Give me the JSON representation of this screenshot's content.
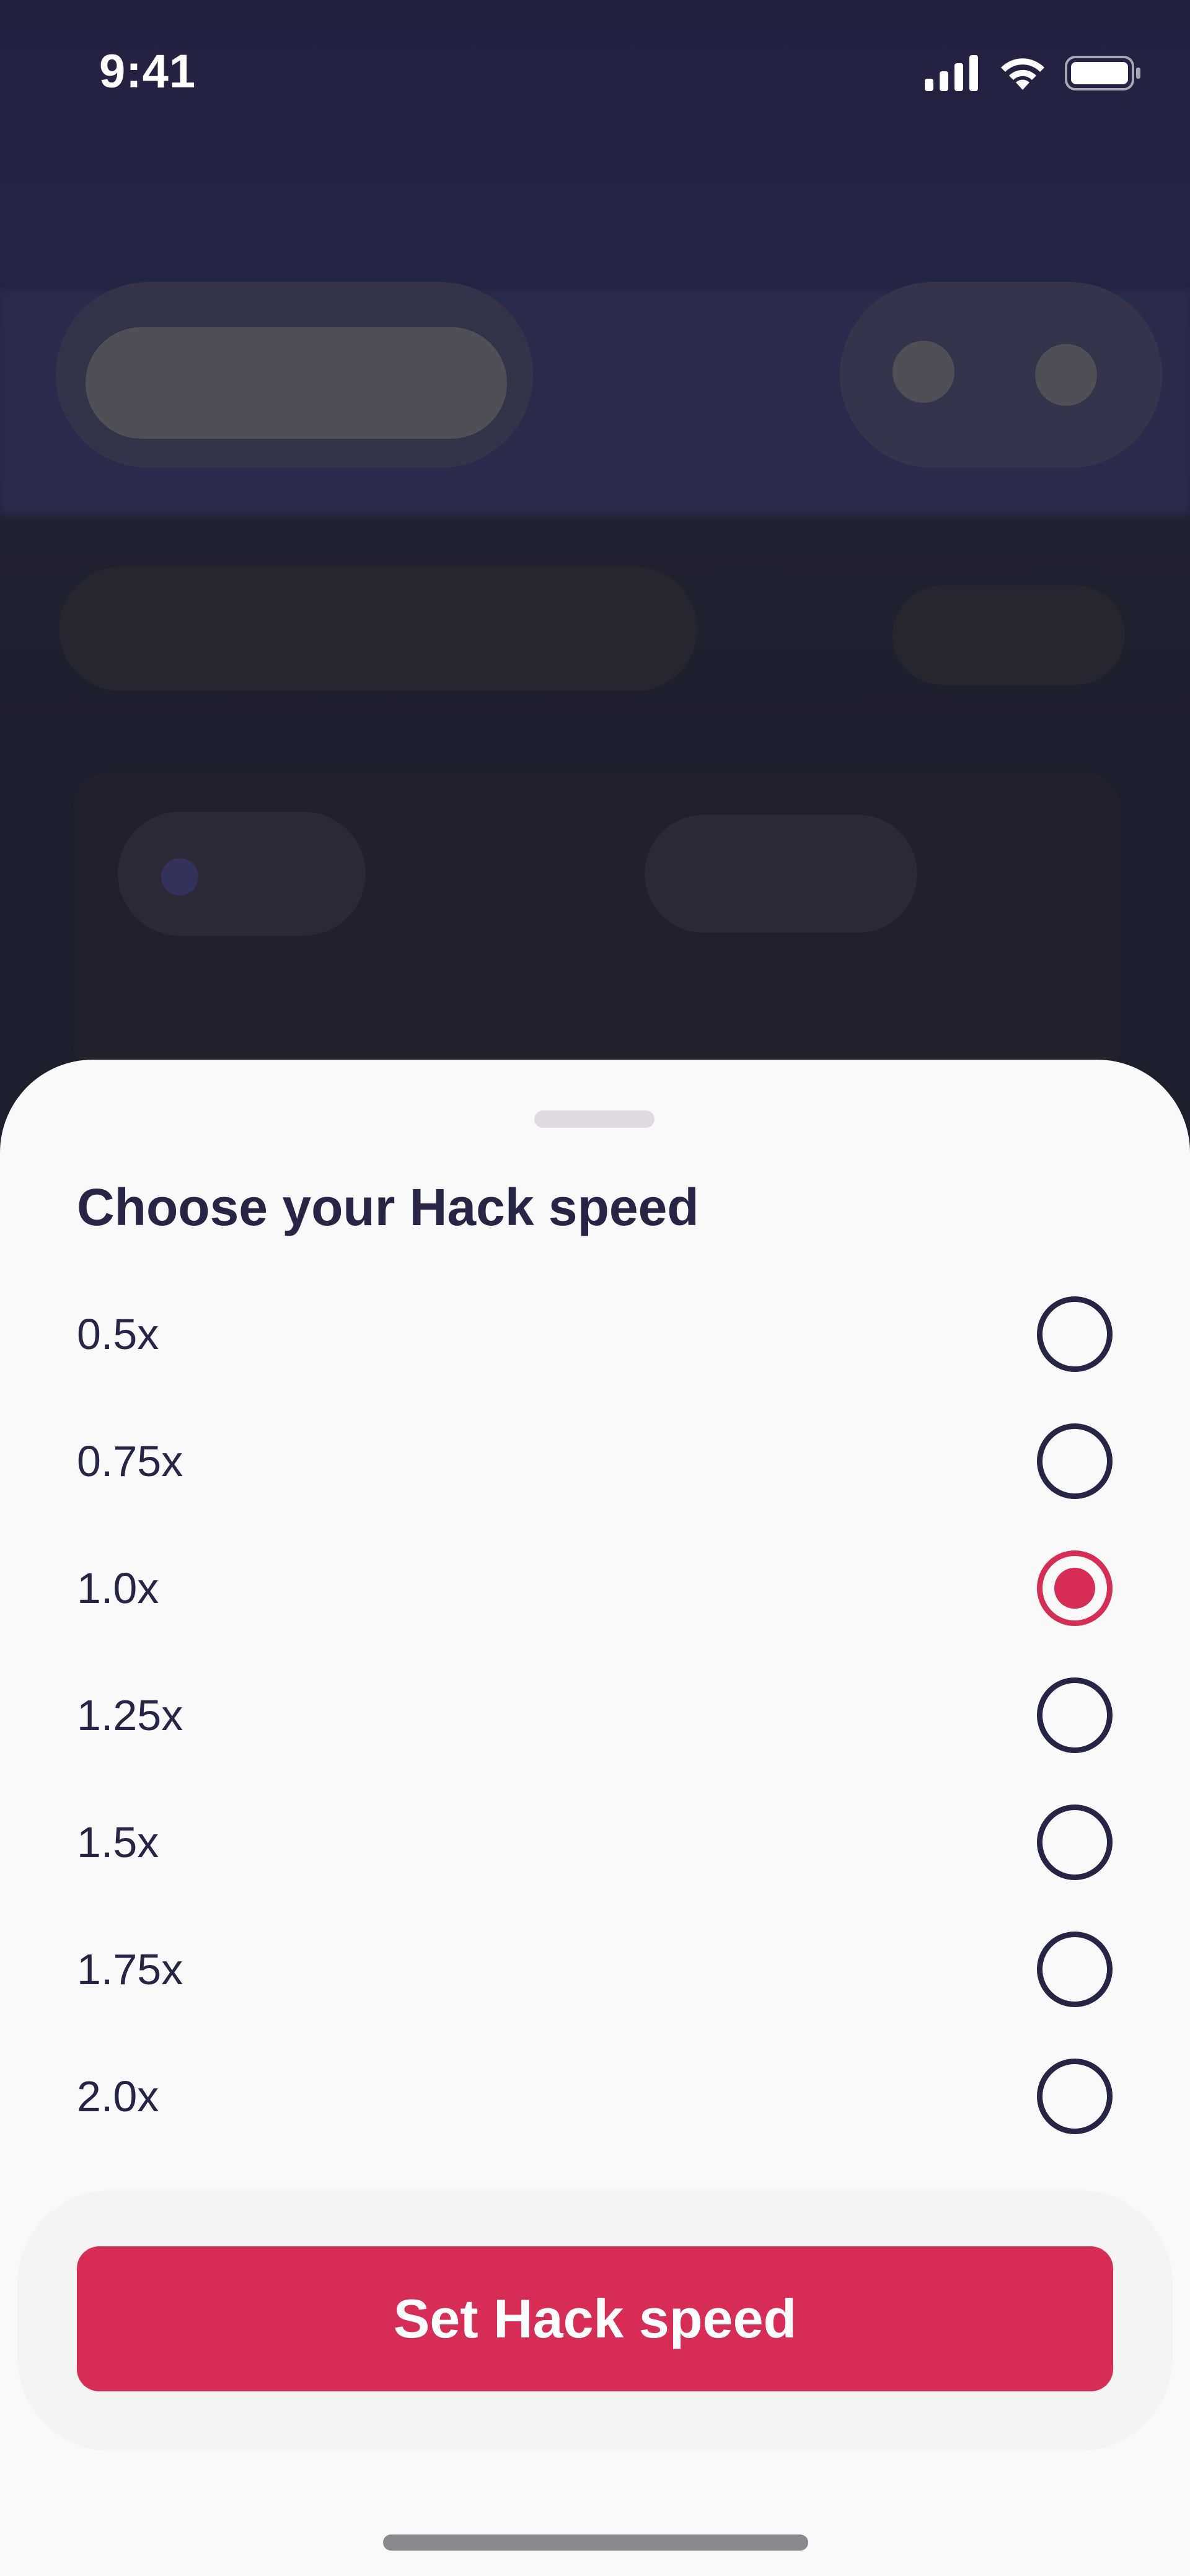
{
  "status_bar": {
    "time": "9:41",
    "icons": [
      "cellular-signal-icon",
      "wifi-icon",
      "battery-icon"
    ]
  },
  "sheet": {
    "title": "Choose your Hack speed",
    "options": [
      {
        "label": "0.5x",
        "selected": false
      },
      {
        "label": "0.75x",
        "selected": false
      },
      {
        "label": "1.0x",
        "selected": true
      },
      {
        "label": "1.25x",
        "selected": false
      },
      {
        "label": "1.5x",
        "selected": false
      },
      {
        "label": "1.75x",
        "selected": false
      },
      {
        "label": "2.0x",
        "selected": false
      }
    ],
    "selected_value": "1.0x",
    "button_label": "Set Hack speed"
  },
  "colors": {
    "accent": "#d62c56",
    "text_primary": "#272543",
    "sheet_background": "#f9f9f9",
    "backdrop": "#24213f"
  }
}
